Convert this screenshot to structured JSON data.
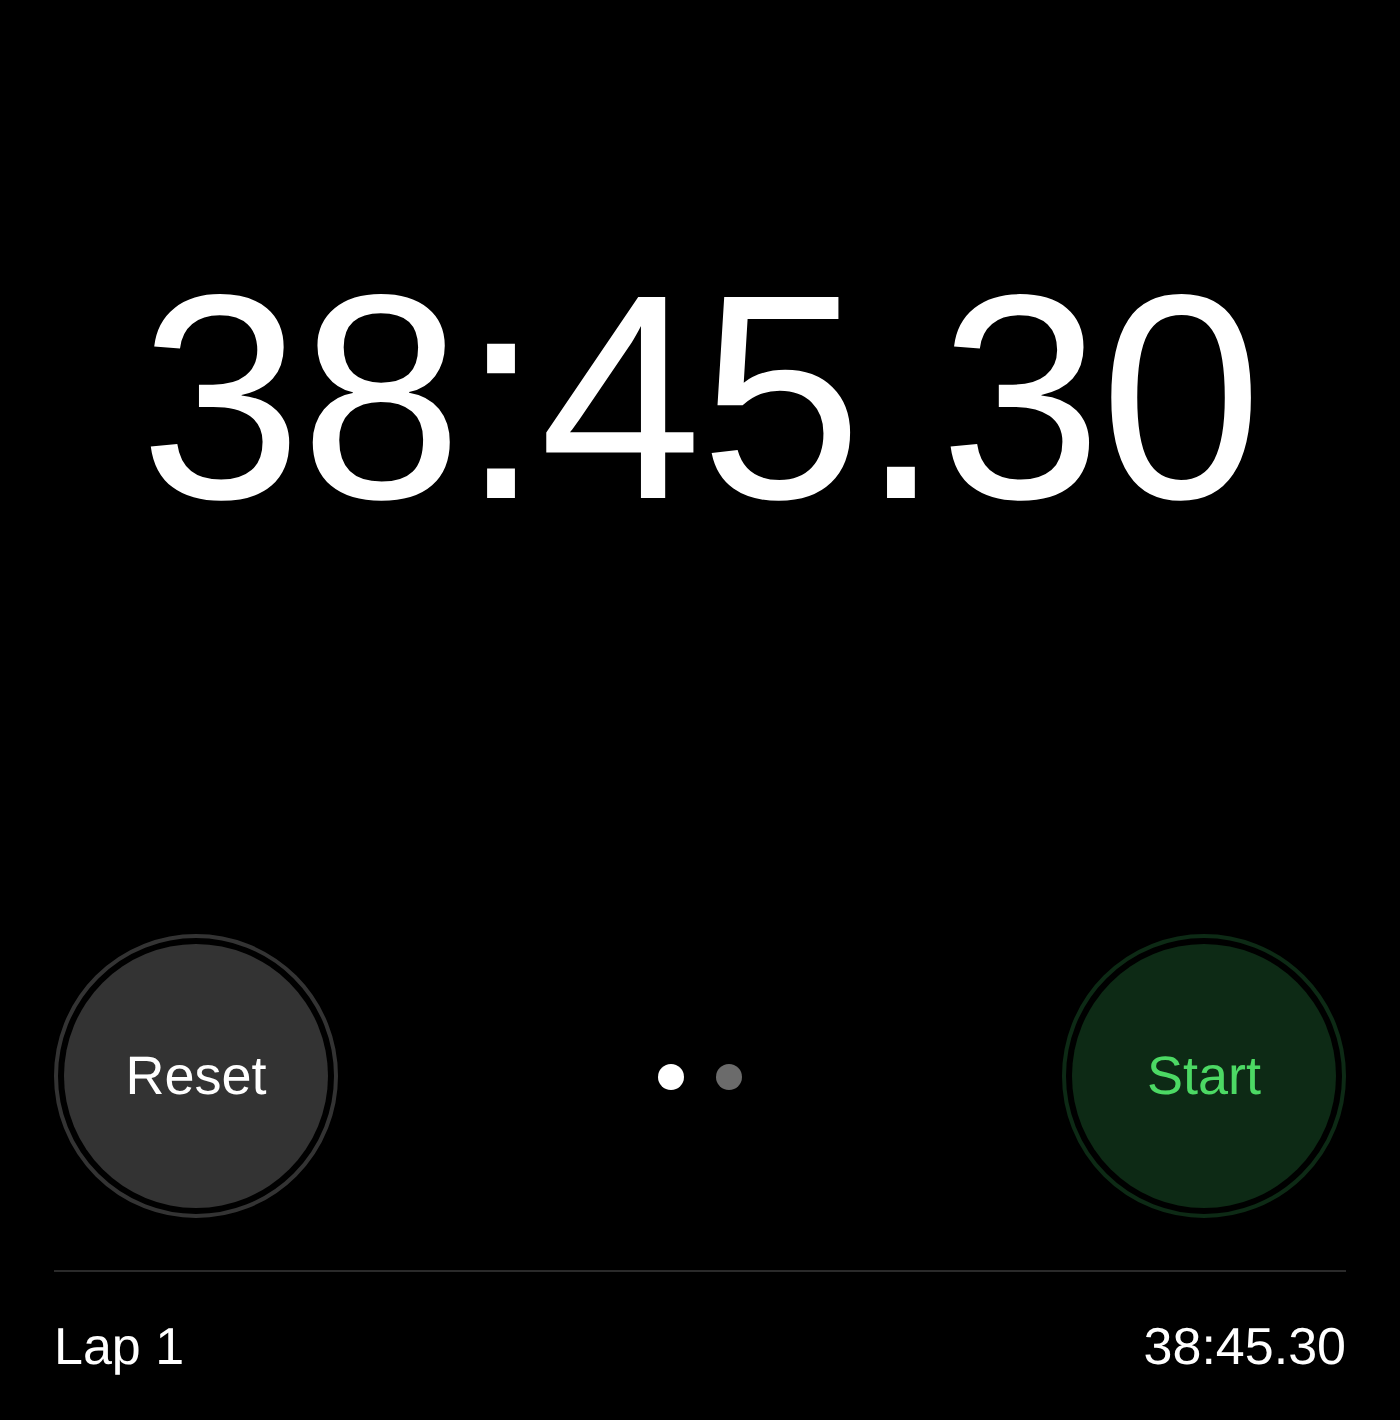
{
  "display": {
    "time": "38:45.30"
  },
  "buttons": [
    {
      "label": "Reset",
      "kind": "reset"
    },
    {
      "label": "Start",
      "kind": "start"
    }
  ],
  "page_dots": [
    {
      "selected": true
    },
    {
      "selected": false
    }
  ],
  "laps": [
    {
      "label": "Lap 1",
      "time": "38:45.30"
    }
  ]
}
